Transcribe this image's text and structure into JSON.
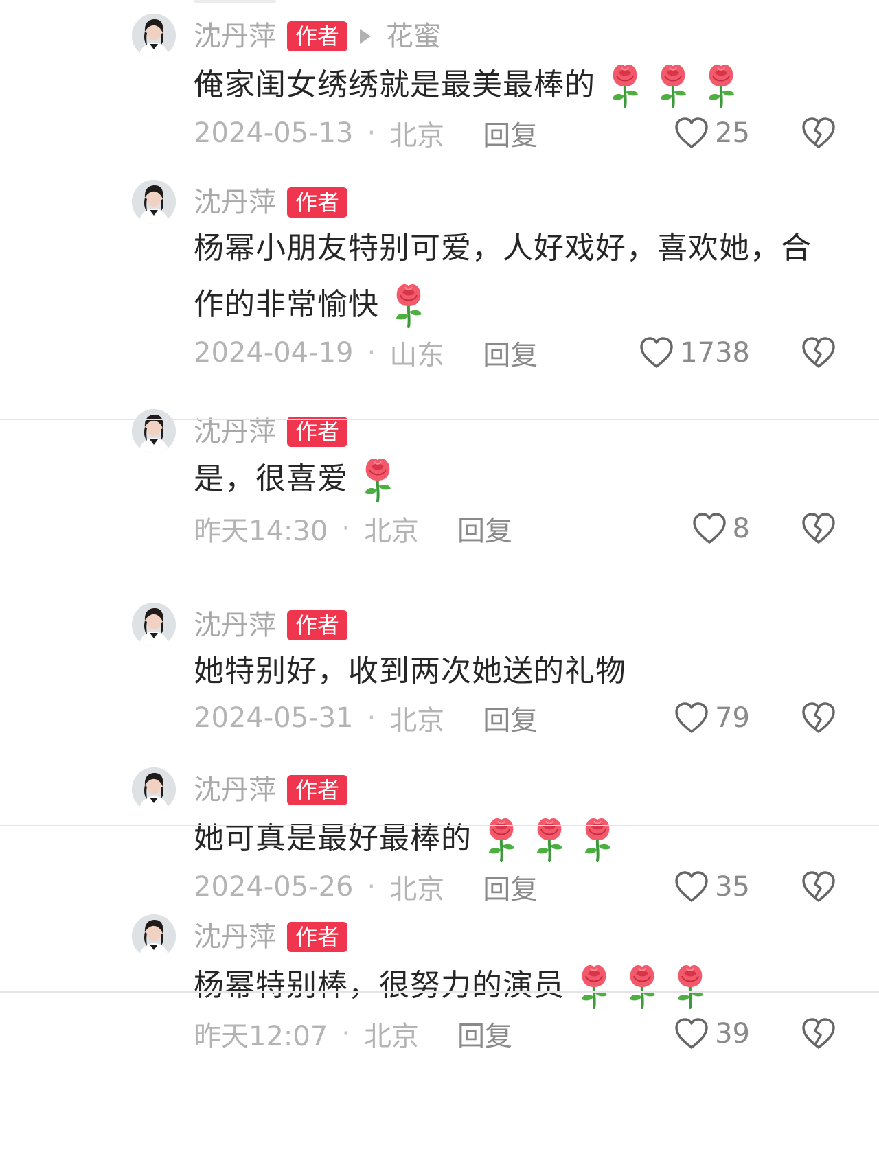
{
  "comments": [
    {
      "username": "沈丹萍",
      "badge": "作者",
      "reply_target": "花蜜",
      "lines": [
        "俺家闺女绣绣就是最美最棒的"
      ],
      "rose_count": 3,
      "date": "2024-05-13",
      "location": "北京",
      "reply_label": "回复",
      "likes": "25"
    },
    {
      "username": "沈丹萍",
      "badge": "作者",
      "lines": [
        "杨幂小朋友特别可爱，人好戏好，喜欢她，合",
        "作的非常愉快"
      ],
      "rose_count": 1,
      "date": "2024-04-19",
      "location": "山东",
      "reply_label": "回复",
      "likes": "1738"
    },
    {
      "username": "沈丹萍",
      "badge": "作者",
      "lines": [
        "是，很喜爱"
      ],
      "rose_count": 1,
      "date": "昨天14:30",
      "location": "北京",
      "reply_label": "回复",
      "likes": "8"
    },
    {
      "username": "沈丹萍",
      "badge": "作者",
      "lines": [
        "她特别好，收到两次她送的礼物"
      ],
      "rose_count": 0,
      "date": "2024-05-31",
      "location": "北京",
      "reply_label": "回复",
      "likes": "79"
    },
    {
      "username": "沈丹萍",
      "badge": "作者",
      "lines": [
        "她可真是最好最棒的"
      ],
      "rose_count": 3,
      "date": "2024-05-26",
      "location": "北京",
      "reply_label": "回复",
      "likes": "35"
    },
    {
      "username": "沈丹萍",
      "badge": "作者",
      "lines": [
        "杨幂特别棒，很努力的演员"
      ],
      "rose_count": 3,
      "date": "昨天12:07",
      "location": "北京",
      "reply_label": "回复",
      "likes": "39"
    }
  ],
  "colors": {
    "author_badge": "#f0364e",
    "rose": "#f25a6b",
    "muted_text": "#a9a9a9",
    "body_text": "#262626"
  },
  "icons": {
    "reply_arrow": "play-triangle-icon",
    "rose": "rose-emoji-icon",
    "like": "heart-outline-icon",
    "dislike": "broken-heart-icon",
    "avatar": "user-avatar-photo"
  }
}
